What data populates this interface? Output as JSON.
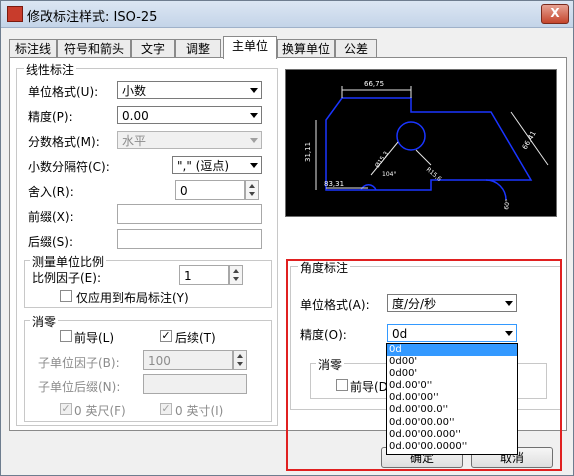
{
  "window": {
    "title": "修改标注样式: ISO-25",
    "close_label": "X"
  },
  "tabs": [
    {
      "label": "标注线"
    },
    {
      "label": "符号和箭头"
    },
    {
      "label": "文字"
    },
    {
      "label": "调整"
    },
    {
      "label": "主单位"
    },
    {
      "label": "换算单位"
    },
    {
      "label": "公差"
    }
  ],
  "active_tab": "主单位",
  "linear": {
    "group_label": "线性标注",
    "unit_format_label": "单位格式(U):",
    "unit_format_value": "小数",
    "precision_label": "精度(P):",
    "precision_value": "0.00",
    "fraction_format_label": "分数格式(M):",
    "fraction_format_value": "水平",
    "decimal_sep_label": "小数分隔符(C):",
    "decimal_sep_value": "\",\" (逗点)",
    "round_off_label": "舍入(R):",
    "round_off_value": "0",
    "prefix_label": "前缀(X):",
    "prefix_value": "",
    "suffix_label": "后缀(S):",
    "suffix_value": ""
  },
  "measurement_scale": {
    "group_label": "测量单位比例",
    "scale_factor_label": "比例因子(E):",
    "scale_factor_value": "1",
    "apply_layout_label": "仅应用到布局标注(Y)"
  },
  "zero_suppression": {
    "group_label": "消零",
    "leading_label": "前导(L)",
    "trailing_label": "后续(T)",
    "sub_unit_factor_label": "子单位因子(B):",
    "sub_unit_factor_value": "100",
    "sub_unit_suffix_label": "子单位后缀(N):",
    "sub_unit_suffix_value": "",
    "feet_label": "0 英尺(F)",
    "inches_label": "0 英寸(I)"
  },
  "preview": {
    "dim_top": "66,75",
    "dim_left": "31,11",
    "dim_right": "66,41",
    "dim_bottom_left": "83,31",
    "dim_radius": "R15,6",
    "dim_angle": "104°",
    "dim_diameter": "Ø15,3",
    "dim_arrow": "60°"
  },
  "angular": {
    "group_label": "角度标注",
    "unit_format_label": "单位格式(A):",
    "unit_format_value": "度/分/秒",
    "precision_label": "精度(O):",
    "precision_value": "0d",
    "zero_label": "消零",
    "leading_label": "前导(D)",
    "precision_options": [
      "0d",
      "0d00'",
      "0d00'",
      "0d.00'0''",
      "0d.00'00''",
      "0d.00'00.0''",
      "0d.00'00.00''",
      "0d.00'00.000''",
      "0d.00'00.0000''"
    ]
  },
  "buttons": {
    "ok": "确定",
    "cancel": "取消"
  },
  "colors": {
    "highlight_box": "#e02020",
    "selection": "#3399ff",
    "preview_bg": "#000000",
    "preview_shape": "#1a35ff"
  }
}
